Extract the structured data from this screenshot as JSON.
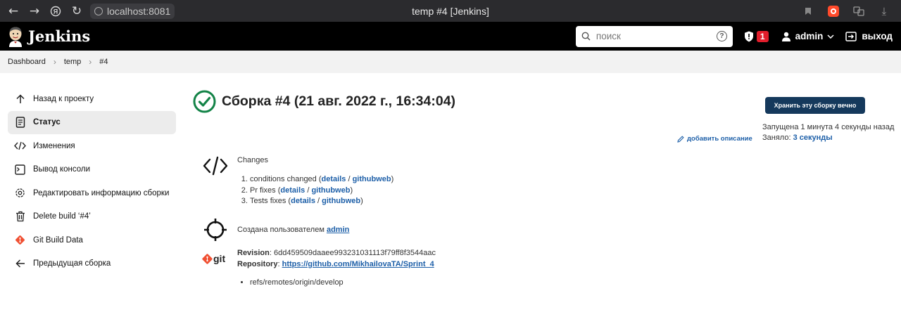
{
  "browser": {
    "url": "localhost:8081",
    "tab_title": "temp #4 [Jenkins]"
  },
  "header": {
    "brand": "Jenkins",
    "search_placeholder": "поиск",
    "search_help": "?",
    "alerts_count": "1",
    "user": "admin",
    "logout": "выход"
  },
  "breadcrumbs": [
    "Dashboard",
    "temp",
    "#4"
  ],
  "sidebar": {
    "items": [
      {
        "label": "Назад к проекту",
        "icon": "arrow-up-icon"
      },
      {
        "label": "Статус",
        "icon": "document-icon"
      },
      {
        "label": "Изменения",
        "icon": "code-icon"
      },
      {
        "label": "Вывод консоли",
        "icon": "terminal-icon"
      },
      {
        "label": "Редактировать информацию сборки",
        "icon": "gear-icon"
      },
      {
        "label": "Delete build ‘#4’",
        "icon": "trash-icon"
      },
      {
        "label": "Git Build Data",
        "icon": "git-icon"
      },
      {
        "label": "Предыдущая сборка",
        "icon": "arrow-left-icon"
      }
    ]
  },
  "build": {
    "title": "Сборка #4 (21 авг. 2022 г., 16:34:04)",
    "status_color": "#138347",
    "keep_label": "Хранить эту сборку вечно",
    "started": "Запущена 1 минута 4 секунды назад",
    "took_label": "Заняло:",
    "took_value": "3 секунды",
    "add_description": "добавить описание"
  },
  "changes": {
    "heading": "Changes",
    "items": [
      {
        "text": "conditions changed",
        "details": "details",
        "githubweb": "githubweb"
      },
      {
        "text": "Pr fixes",
        "details": "details",
        "githubweb": "githubweb"
      },
      {
        "text": "Tests fixes",
        "details": "details",
        "githubweb": "githubweb"
      }
    ]
  },
  "cause": {
    "text": "Создана пользователем",
    "user": "admin"
  },
  "git": {
    "logo_text": "git",
    "revision_label": "Revision",
    "revision": "6dd459509daaee993231031113f79ff8f3544aac",
    "repository_label": "Repository",
    "repository": "https://github.com/MikhailovaTA/Sprint_4",
    "branches": [
      "refs/remotes/origin/develop"
    ]
  },
  "colors": {
    "accent": "#15395c",
    "link": "#1d5fa8",
    "badge": "#e11d2b",
    "git": "#f05033"
  }
}
